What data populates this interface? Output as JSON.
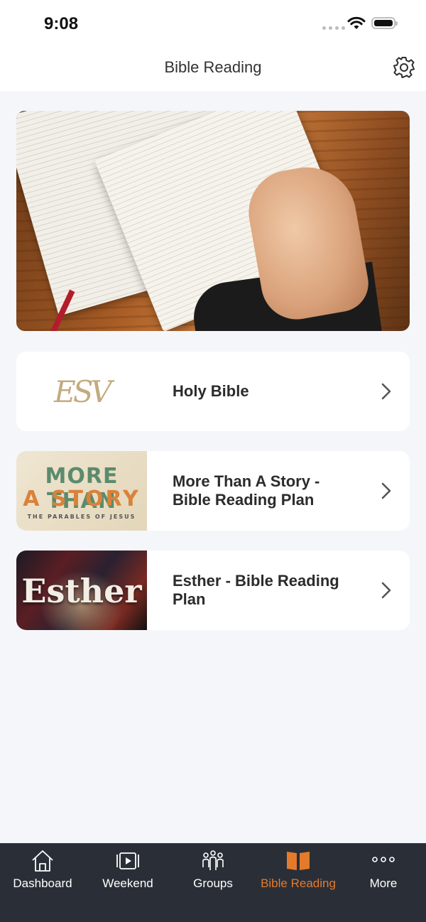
{
  "status_bar": {
    "time": "9:08"
  },
  "header": {
    "title": "Bible Reading",
    "settings_icon": "gear-icon"
  },
  "hero": {
    "image": "open-bible-on-wooden-table"
  },
  "list": [
    {
      "title": "Holy Bible",
      "thumb_text": "ESV",
      "thumb": "esv-logo"
    },
    {
      "title": "More Than A Story - Bible Reading Plan",
      "thumb_text": [
        "MORE THAN",
        "A STORY",
        "THE PARABLES OF JESUS"
      ],
      "thumb": "more-than-a-story-artwork"
    },
    {
      "title": "Esther - Bible Reading Plan",
      "thumb_text": "Esther",
      "thumb": "esther-artwork"
    }
  ],
  "tabs": [
    {
      "label": "Dashboard",
      "icon": "home-icon",
      "active": false
    },
    {
      "label": "Weekend",
      "icon": "video-icon",
      "active": false
    },
    {
      "label": "Groups",
      "icon": "groups-icon",
      "active": false
    },
    {
      "label": "Bible Reading",
      "icon": "book-icon",
      "active": true
    },
    {
      "label": "More",
      "icon": "more-icon",
      "active": false
    }
  ],
  "colors": {
    "accent": "#e47a2b",
    "tab_bar": "#2a2f37",
    "background": "#f4f6fa"
  }
}
